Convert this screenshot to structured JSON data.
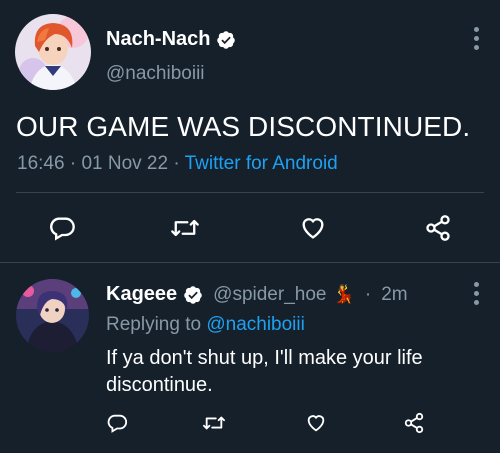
{
  "main_tweet": {
    "display_name": "Nach-Nach",
    "handle": "@nachiboiii",
    "text": "OUR GAME WAS DISCONTINUED.",
    "time": "16:46",
    "date": "01 Nov 22",
    "separator": "·",
    "source": "Twitter for Android"
  },
  "reply_tweet": {
    "display_name": "Kageee",
    "handle": "@spider_hoe",
    "handle_emoji": "💃",
    "age": "2m",
    "replying_prefix": "Replying to",
    "replying_to": "@nachiboiii",
    "text": "If ya don't shut up, I'll make your life discontinue."
  },
  "icons": {
    "reply": "reply-icon",
    "retweet": "retweet-icon",
    "like": "like-icon",
    "share": "share-icon",
    "verified": "verified-badge-icon",
    "more": "more-vertical-icon"
  },
  "colors": {
    "background": "#15202b",
    "secondary_text": "#8899a6",
    "link": "#1da1f2",
    "divider": "#38444d"
  }
}
